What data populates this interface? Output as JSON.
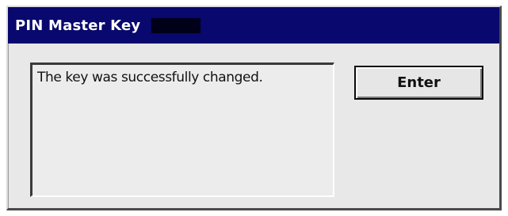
{
  "dialog": {
    "title": "PIN Master Key",
    "message": "The key was successfully changed.",
    "enter_label": "Enter"
  },
  "colors": {
    "titlebar": "#08086e",
    "title_text": "#ffffff",
    "window_background": "#e8e8e8"
  }
}
